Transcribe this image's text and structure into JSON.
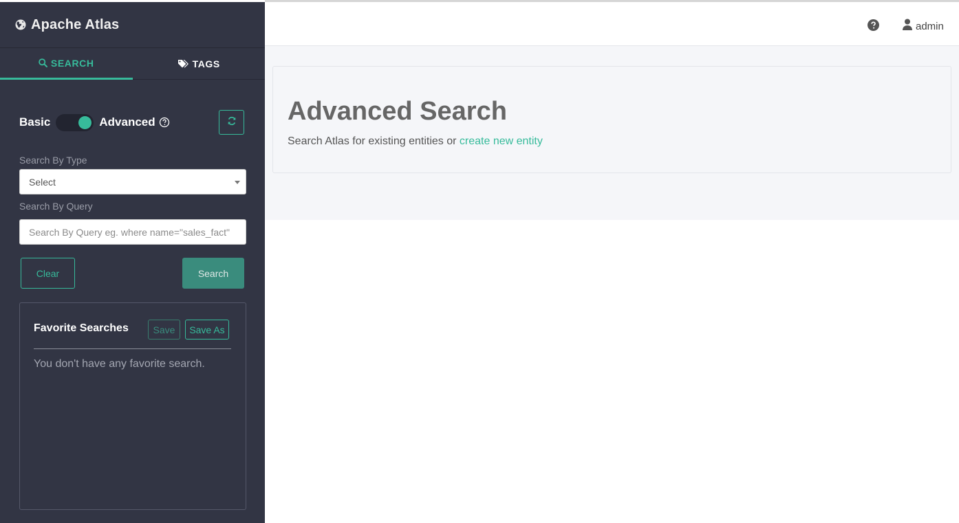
{
  "brand": {
    "title": "Apache Atlas",
    "icon": "globe-icon"
  },
  "tabs": [
    {
      "label": "SEARCH",
      "icon": "search-icon",
      "active": true
    },
    {
      "label": "TAGS",
      "icon": "tags-icon",
      "active": false
    }
  ],
  "mode_toggle": {
    "left_label": "Basic",
    "right_label": "Advanced",
    "state": "Advanced"
  },
  "search_by_type": {
    "label": "Search By Type",
    "value": "Select"
  },
  "search_by_query": {
    "label": "Search By Query",
    "placeholder": "Search By Query eg. where name=\"sales_fact\""
  },
  "buttons": {
    "clear": "Clear",
    "search": "Search"
  },
  "favorites": {
    "title": "Favorite Searches",
    "save": "Save",
    "save_as": "Save As",
    "empty_message": "You don't have any favorite search."
  },
  "header": {
    "user": "admin"
  },
  "main": {
    "title": "Advanced Search",
    "subtitle_prefix": "Search Atlas for existing entities or ",
    "create_link": "create new entity"
  },
  "colors": {
    "accent": "#37bb9b",
    "sidebar": "#323544",
    "button_dark": "#3a8c7d"
  }
}
